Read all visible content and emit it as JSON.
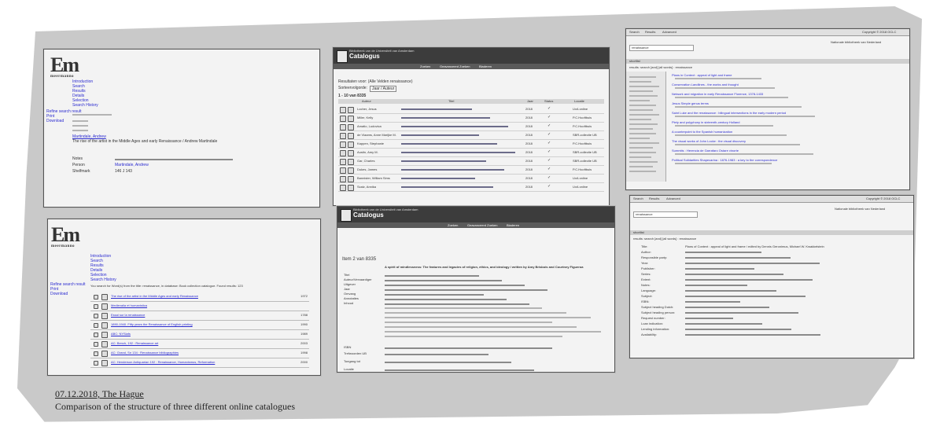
{
  "caption": {
    "date": "07.12.2018, The Hague",
    "title": "Comparison of the structure of three different online catalogues"
  },
  "meermanno": {
    "logo_letters": "Em",
    "logo_sub": "meermanno",
    "logo_side": "museum",
    "nav": [
      "Introduction",
      "Search",
      "Results",
      "Details",
      "Selection",
      "Search History"
    ],
    "left_links": [
      "Refine search result",
      "Print",
      "Download"
    ],
    "record_title": "The rise of the artist in the Middle Ages and early Renaissance / Andrew Martindale",
    "record_author": "Martindale, Andrew",
    "notes_label": "Notes",
    "person_label": "Person",
    "shelfmark_label": "Shelfmark",
    "shelfmark_value": "146 J 143",
    "results_heading": "You search for Word(s) from the title: renaissance, in database: Book collection catalogue. Found results: 123",
    "result_items": [
      {
        "title": "The rise of the artist in the Middle Ages and early Renaissance",
        "year": "1972"
      },
      {
        "title": "Medievalia et humanistica",
        "year": ""
      },
      {
        "title": "Essai sur la renaissance",
        "year": "1788"
      },
      {
        "title": "1890-1940. Fifty years the Renaissance of English printing",
        "year": "1990"
      },
      {
        "title": "ABC: NYSiafs",
        "year": "1989"
      },
      {
        "title": "AC: Bench, 192 : Renaissance art",
        "year": "2003"
      },
      {
        "title": "AC: Grand, Sn 134 : Renaissance bibliographies",
        "year": "1998"
      },
      {
        "title": "AC: Henderson Antiquarian 192 : Renaissance, Humanismus, Reformation",
        "year": "2000"
      }
    ]
  },
  "uva": {
    "institution": "Bibliotheek van de Universiteit van Amsterdam",
    "title": "Catalogus",
    "tabs": [
      "Zoeken",
      "Geavanceerd Zoeken",
      "Bladeren"
    ],
    "results_label": "Resultaten voor: (Alle Velden renaissance)",
    "sort_label": "Sorteervolgorde:",
    "sort_value": "Jaar / Auteur",
    "count_label": "1 - 10 van 8335",
    "item_label": "Item 2 van 8335",
    "columns": [
      "Auteur",
      "Titel",
      "Jaar",
      "Status",
      "Locatie"
    ],
    "rows": [
      {
        "author": "Locher, Jesus",
        "year": "2018",
        "location": "UvA online"
      },
      {
        "author": "Miller, Kelly",
        "year": "2018",
        "location": "P.C.Hooftbuis"
      },
      {
        "author": "Amatio, Ludovica",
        "year": "2018",
        "location": "P.C.Hooftbuis"
      },
      {
        "author": "de Vlaams, Anne Marijke M.",
        "year": "2018",
        "location": "SBR-collectie UB"
      },
      {
        "author": "Kappen, Stephanie",
        "year": "2018",
        "location": "P.C.Hooftbuis"
      },
      {
        "author": "Austin, Amy M.",
        "year": "2018",
        "location": "SBR-collectie UB"
      },
      {
        "author": "Gar, Charles",
        "year": "2018",
        "location": "SBR-collectie UB"
      },
      {
        "author": "Dukes, James",
        "year": "2018",
        "location": "P.C.Hooftbuis"
      },
      {
        "author": "Bannister, William Sims",
        "year": "2018",
        "location": "UvA online"
      },
      {
        "author": "Scalz, Annika",
        "year": "2018",
        "location": "UvA online"
      }
    ],
    "detail_labels": [
      "Titel",
      "Auteur/Vervaardiger",
      "Uitgever",
      "Jaar",
      "Omvang",
      "Annotaties",
      "Inhoud",
      "ISBN",
      "Trefwoorden UB",
      "Toegang tot",
      "Locatie",
      "Permalink"
    ],
    "detail_title": "A spirit of mindlessness: The features and legacies of religion, ethics, and ideology / written by Amy Brisbois and Courtney Figueroa",
    "detail_year": "2018"
  },
  "kb": {
    "topnav": [
      "Search",
      "Results",
      "Advanced",
      "My shelf",
      "Browser information",
      "Help"
    ],
    "copyright": "Copyright © 2018 OCLC",
    "institution": "Nationale bibliotheek van Nederland",
    "search_value": "renaissance",
    "shortlist_label": "shortlist",
    "results_label": "results: search [and] [all words] : renaissance",
    "items": [
      "Plans in Context : appeal of light and frame",
      "Conservation Landlines - the works and thought",
      "Network and migration in early Renaissance Florence, 1378-1433",
      "Jesus Simple genus terms",
      "Saint Luke and the renaissance : bilingual intersections in the early modern period",
      "Piety and polyphony in sixteenth-century Holland",
      "A counterpoint to the Spanish humanization",
      "The visual works of John Locke : the visual discovery",
      "Summits : Herencia de Garrafaro Ostare vinorte",
      "Political Solidarities Shapecarina : 1876-1983 : a key to the correspondence"
    ],
    "detail_labels": [
      "Title:",
      "Author:",
      "Responsible party:",
      "Year:",
      "Publisher:",
      "Series:",
      "Extent:",
      "Notes:",
      "Language:",
      "Subject:",
      "ISBN:",
      "Subject heading Dutch:",
      "Subject heading person:",
      "Request number:",
      "Loan indication:",
      "Lending information:",
      "Availability:"
    ],
    "detail_title": "Plans of Context : appeal of light and frame / edited by Dennis Geronimus, Michael W. Kwakkelstein",
    "detail_year": "2018"
  }
}
